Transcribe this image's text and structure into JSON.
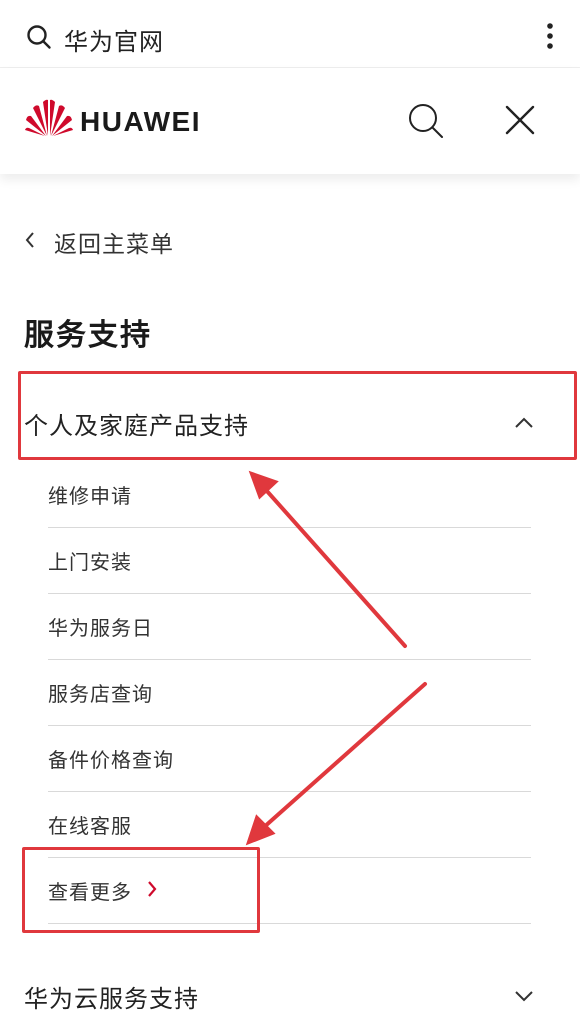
{
  "browser": {
    "title": "华为官网"
  },
  "header": {
    "brand": "HUAWEI"
  },
  "nav": {
    "back_label": "返回主菜单",
    "section_title": "服务支持"
  },
  "accordion": {
    "expanded_label": "个人及家庭产品支持",
    "items": [
      {
        "label": "维修申请"
      },
      {
        "label": "上门安装"
      },
      {
        "label": "华为服务日"
      },
      {
        "label": "服务店查询"
      },
      {
        "label": "备件价格查询"
      },
      {
        "label": "在线客服"
      }
    ],
    "more_label": "查看更多",
    "collapsed_label": "华为云服务支持"
  },
  "colors": {
    "highlight": "#e0383d",
    "brand_red": "#cf0a2c"
  }
}
